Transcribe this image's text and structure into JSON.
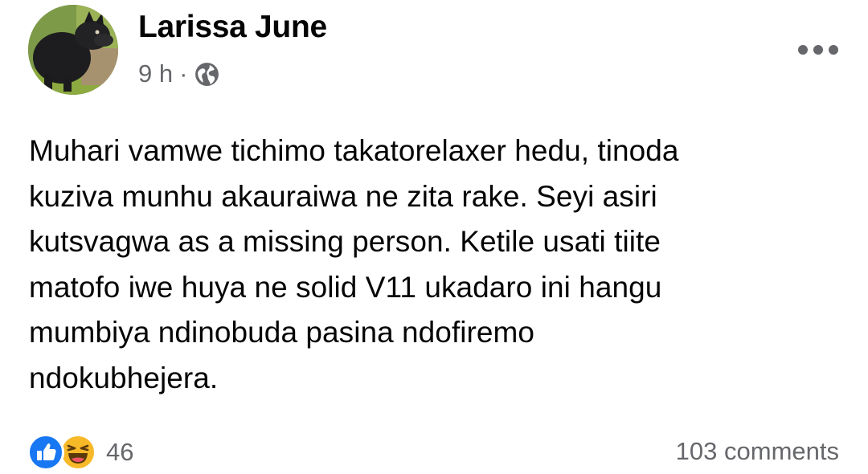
{
  "post": {
    "author_name": "Larissa June",
    "time_ago": "9 h",
    "separator": "·",
    "audience_icon": "globe-icon",
    "menu_icon": "more-horizontal-icon",
    "body_lines": [
      "Muhari vamwe tichimo takatorelaxer hedu, tinoda",
      "kuziva munhu akauraiwa ne zita rake. Seyi asiri",
      "kutsvagwa as a missing person. Ketile usati tiite",
      "matofo iwe huya ne solid V11 ukadaro ini hangu",
      "mumbiya ndinobuda pasina ndofiremo",
      "ndokubhejera."
    ]
  },
  "footer": {
    "reactions": [
      "like-icon",
      "haha-icon"
    ],
    "reaction_count": "46",
    "comments_label": "103 comments"
  },
  "colors": {
    "text_primary": "#050505",
    "text_secondary": "#65676b",
    "like_blue": "#1877f2",
    "haha_yellow": "#f7b928"
  }
}
